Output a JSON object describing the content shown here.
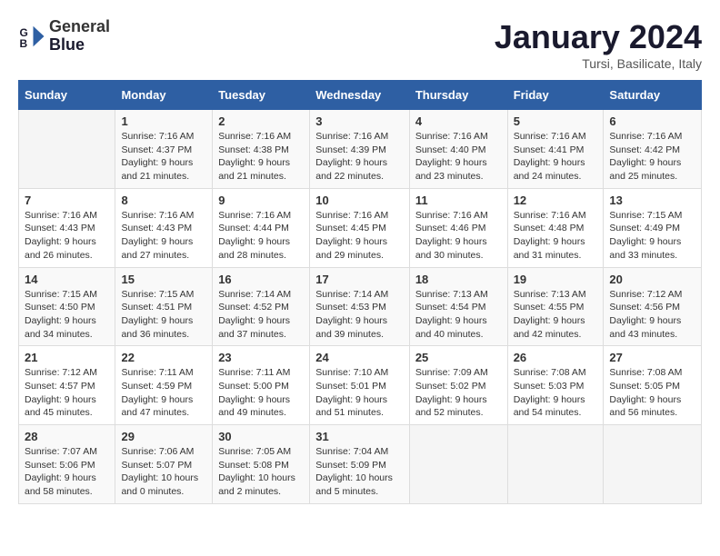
{
  "logo": {
    "line1": "General",
    "line2": "Blue"
  },
  "title": "January 2024",
  "subtitle": "Tursi, Basilicate, Italy",
  "weekdays": [
    "Sunday",
    "Monday",
    "Tuesday",
    "Wednesday",
    "Thursday",
    "Friday",
    "Saturday"
  ],
  "weeks": [
    [
      {
        "day": "",
        "info": ""
      },
      {
        "day": "1",
        "info": "Sunrise: 7:16 AM\nSunset: 4:37 PM\nDaylight: 9 hours\nand 21 minutes."
      },
      {
        "day": "2",
        "info": "Sunrise: 7:16 AM\nSunset: 4:38 PM\nDaylight: 9 hours\nand 21 minutes."
      },
      {
        "day": "3",
        "info": "Sunrise: 7:16 AM\nSunset: 4:39 PM\nDaylight: 9 hours\nand 22 minutes."
      },
      {
        "day": "4",
        "info": "Sunrise: 7:16 AM\nSunset: 4:40 PM\nDaylight: 9 hours\nand 23 minutes."
      },
      {
        "day": "5",
        "info": "Sunrise: 7:16 AM\nSunset: 4:41 PM\nDaylight: 9 hours\nand 24 minutes."
      },
      {
        "day": "6",
        "info": "Sunrise: 7:16 AM\nSunset: 4:42 PM\nDaylight: 9 hours\nand 25 minutes."
      }
    ],
    [
      {
        "day": "7",
        "info": "Sunrise: 7:16 AM\nSunset: 4:43 PM\nDaylight: 9 hours\nand 26 minutes."
      },
      {
        "day": "8",
        "info": "Sunrise: 7:16 AM\nSunset: 4:43 PM\nDaylight: 9 hours\nand 27 minutes."
      },
      {
        "day": "9",
        "info": "Sunrise: 7:16 AM\nSunset: 4:44 PM\nDaylight: 9 hours\nand 28 minutes."
      },
      {
        "day": "10",
        "info": "Sunrise: 7:16 AM\nSunset: 4:45 PM\nDaylight: 9 hours\nand 29 minutes."
      },
      {
        "day": "11",
        "info": "Sunrise: 7:16 AM\nSunset: 4:46 PM\nDaylight: 9 hours\nand 30 minutes."
      },
      {
        "day": "12",
        "info": "Sunrise: 7:16 AM\nSunset: 4:48 PM\nDaylight: 9 hours\nand 31 minutes."
      },
      {
        "day": "13",
        "info": "Sunrise: 7:15 AM\nSunset: 4:49 PM\nDaylight: 9 hours\nand 33 minutes."
      }
    ],
    [
      {
        "day": "14",
        "info": "Sunrise: 7:15 AM\nSunset: 4:50 PM\nDaylight: 9 hours\nand 34 minutes."
      },
      {
        "day": "15",
        "info": "Sunrise: 7:15 AM\nSunset: 4:51 PM\nDaylight: 9 hours\nand 36 minutes."
      },
      {
        "day": "16",
        "info": "Sunrise: 7:14 AM\nSunset: 4:52 PM\nDaylight: 9 hours\nand 37 minutes."
      },
      {
        "day": "17",
        "info": "Sunrise: 7:14 AM\nSunset: 4:53 PM\nDaylight: 9 hours\nand 39 minutes."
      },
      {
        "day": "18",
        "info": "Sunrise: 7:13 AM\nSunset: 4:54 PM\nDaylight: 9 hours\nand 40 minutes."
      },
      {
        "day": "19",
        "info": "Sunrise: 7:13 AM\nSunset: 4:55 PM\nDaylight: 9 hours\nand 42 minutes."
      },
      {
        "day": "20",
        "info": "Sunrise: 7:12 AM\nSunset: 4:56 PM\nDaylight: 9 hours\nand 43 minutes."
      }
    ],
    [
      {
        "day": "21",
        "info": "Sunrise: 7:12 AM\nSunset: 4:57 PM\nDaylight: 9 hours\nand 45 minutes."
      },
      {
        "day": "22",
        "info": "Sunrise: 7:11 AM\nSunset: 4:59 PM\nDaylight: 9 hours\nand 47 minutes."
      },
      {
        "day": "23",
        "info": "Sunrise: 7:11 AM\nSunset: 5:00 PM\nDaylight: 9 hours\nand 49 minutes."
      },
      {
        "day": "24",
        "info": "Sunrise: 7:10 AM\nSunset: 5:01 PM\nDaylight: 9 hours\nand 51 minutes."
      },
      {
        "day": "25",
        "info": "Sunrise: 7:09 AM\nSunset: 5:02 PM\nDaylight: 9 hours\nand 52 minutes."
      },
      {
        "day": "26",
        "info": "Sunrise: 7:08 AM\nSunset: 5:03 PM\nDaylight: 9 hours\nand 54 minutes."
      },
      {
        "day": "27",
        "info": "Sunrise: 7:08 AM\nSunset: 5:05 PM\nDaylight: 9 hours\nand 56 minutes."
      }
    ],
    [
      {
        "day": "28",
        "info": "Sunrise: 7:07 AM\nSunset: 5:06 PM\nDaylight: 9 hours\nand 58 minutes."
      },
      {
        "day": "29",
        "info": "Sunrise: 7:06 AM\nSunset: 5:07 PM\nDaylight: 10 hours\nand 0 minutes."
      },
      {
        "day": "30",
        "info": "Sunrise: 7:05 AM\nSunset: 5:08 PM\nDaylight: 10 hours\nand 2 minutes."
      },
      {
        "day": "31",
        "info": "Sunrise: 7:04 AM\nSunset: 5:09 PM\nDaylight: 10 hours\nand 5 minutes."
      },
      {
        "day": "",
        "info": ""
      },
      {
        "day": "",
        "info": ""
      },
      {
        "day": "",
        "info": ""
      }
    ]
  ]
}
